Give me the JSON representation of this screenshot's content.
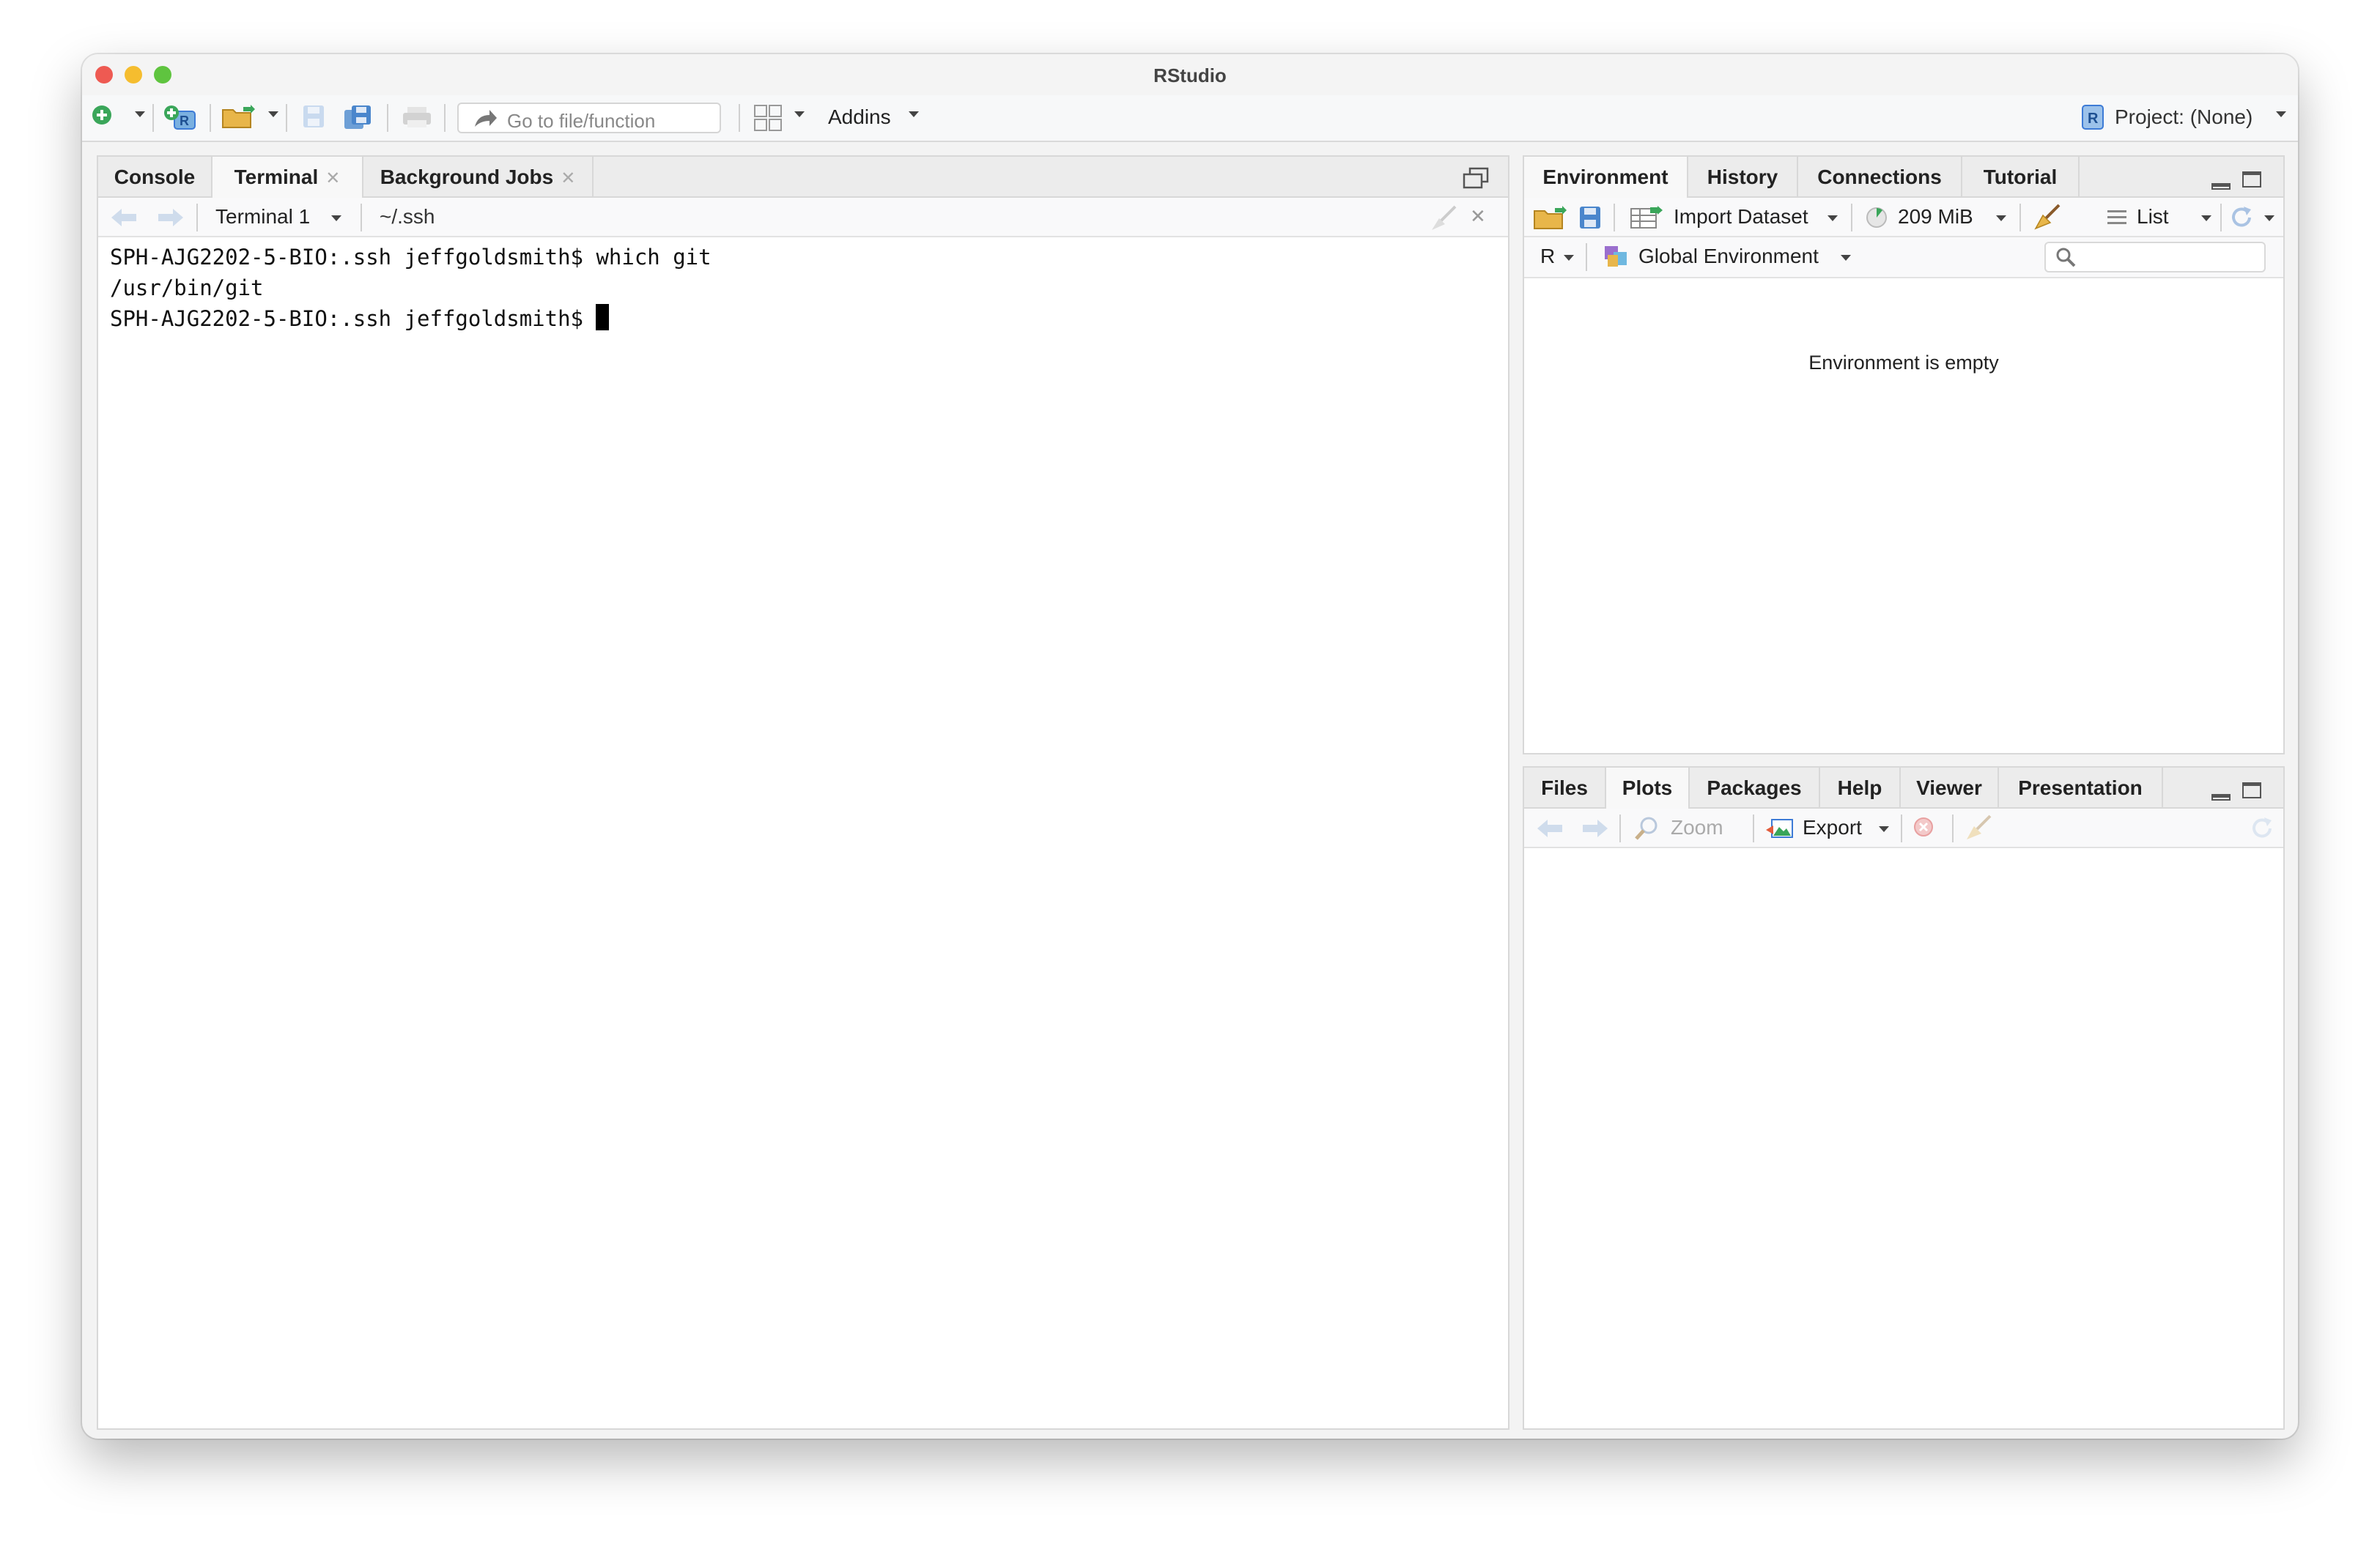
{
  "window": {
    "title": "RStudio"
  },
  "toolbar": {
    "goto_placeholder": "Go to file/function",
    "addins_label": "Addins",
    "project_label": "Project: (None)"
  },
  "left_pane": {
    "tabs": [
      {
        "label": "Console"
      },
      {
        "label": "Terminal"
      },
      {
        "label": "Background Jobs"
      }
    ],
    "terminal_selector": "Terminal 1",
    "terminal_path": "~/.ssh",
    "lines": [
      "SPH-AJG2202-5-BIO:.ssh jeffgoldsmith$ which git",
      "/usr/bin/git",
      "SPH-AJG2202-5-BIO:.ssh jeffgoldsmith$ "
    ]
  },
  "env_pane": {
    "tabs": [
      {
        "label": "Environment"
      },
      {
        "label": "History"
      },
      {
        "label": "Connections"
      },
      {
        "label": "Tutorial"
      }
    ],
    "import_label": "Import Dataset",
    "memory_label": "209 MiB",
    "list_label": "List",
    "language_label": "R",
    "scope_label": "Global Environment",
    "empty_message": "Environment is empty"
  },
  "files_pane": {
    "tabs": [
      {
        "label": "Files"
      },
      {
        "label": "Plots"
      },
      {
        "label": "Packages"
      },
      {
        "label": "Help"
      },
      {
        "label": "Viewer"
      },
      {
        "label": "Presentation"
      }
    ],
    "zoom_label": "Zoom",
    "export_label": "Export"
  },
  "colors": {
    "accent_blue": "#3d7bd6",
    "add_green": "#3aa65a",
    "folder_yellow": "#e8b64a"
  }
}
